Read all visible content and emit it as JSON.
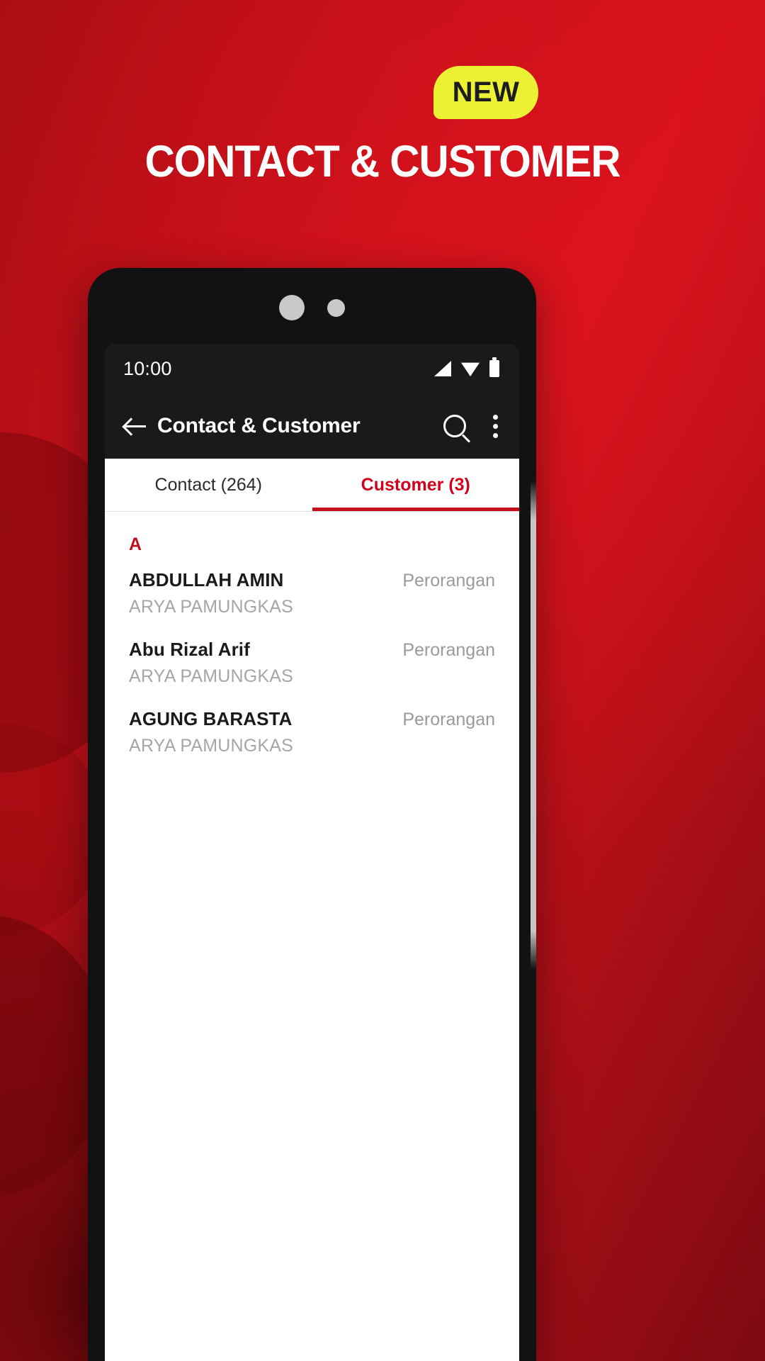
{
  "promo": {
    "badge_label": "NEW",
    "badge_color": "#edf134",
    "headline": "CONTACT & CUSTOMER",
    "background_color": "#bd0f18"
  },
  "phone": {
    "status_bar": {
      "time": "10:00",
      "icons": [
        "signal-icon",
        "wifi-icon",
        "battery-icon"
      ]
    },
    "app_bar": {
      "back_label": "back-arrow-icon",
      "title": "Contact & Customer",
      "search_label": "search-icon",
      "overflow_label": "more-options-icon"
    },
    "tabs": [
      {
        "label": "Contact (264)",
        "active": false
      },
      {
        "label": "Customer (3)",
        "active": true
      }
    ],
    "accent_color": "#c4101c",
    "list": {
      "section_letter": "A",
      "rows": [
        {
          "name": "ABDULLAH AMIN",
          "subtitle": "ARYA PAMUNGKAS",
          "type": "Perorangan"
        },
        {
          "name": "Abu Rizal Arif",
          "subtitle": "ARYA PAMUNGKAS",
          "type": "Perorangan"
        },
        {
          "name": "AGUNG BARASTA",
          "subtitle": "ARYA PAMUNGKAS",
          "type": "Perorangan"
        }
      ]
    }
  }
}
